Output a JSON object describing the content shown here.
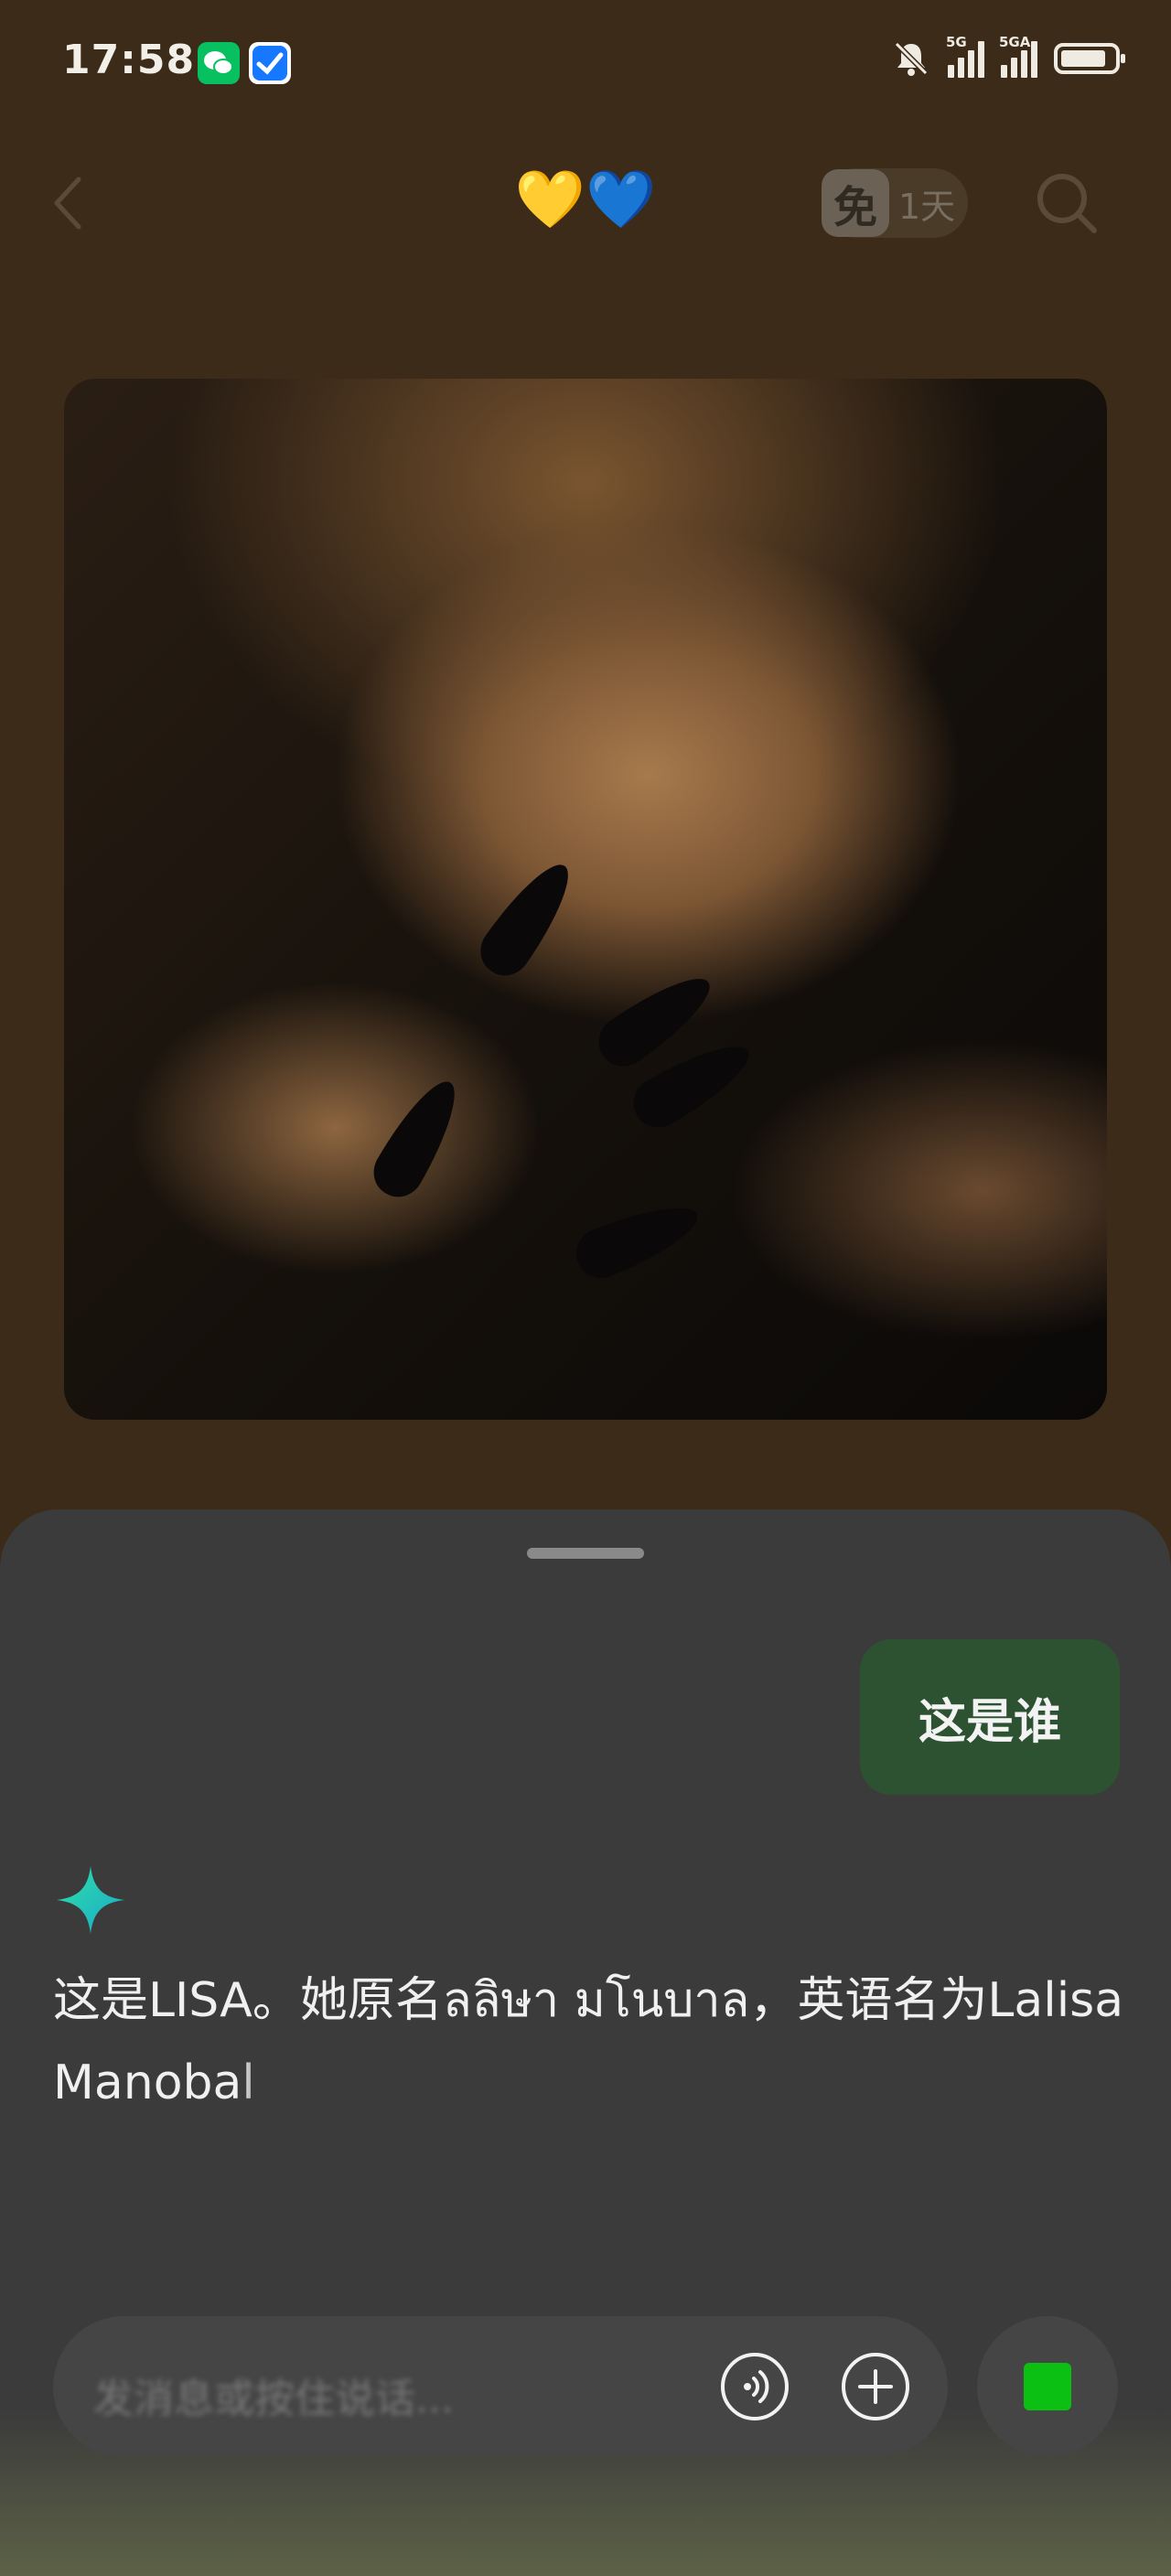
{
  "status_bar": {
    "time": "17:58",
    "apps": [
      "wechat-icon",
      "alipay-icon"
    ],
    "network_1": "5G",
    "network_2": "5GA",
    "icons": [
      "mute-bell-icon",
      "signal-icon",
      "battery-icon"
    ]
  },
  "nav": {
    "title_emoji": "💛💙",
    "free_badge": "免",
    "free_days": "1天",
    "icons": [
      "back-chevron-icon",
      "search-icon"
    ]
  },
  "photo": {
    "alt_icon": "portrait-image"
  },
  "chat": {
    "user_message": "这是谁",
    "ai_response_main": "这是LISA。她原名ลลิษา มโนบาล，英语名为Lalisa Manoba",
    "ai_response_fading": "l",
    "icons": [
      "sparkle-icon"
    ]
  },
  "composer": {
    "placeholder": "发消息或按住说话...",
    "icons": [
      "voice-call-icon",
      "plus-icon",
      "stop-icon"
    ]
  },
  "colors": {
    "background": "#3c2b18",
    "sheet": "#3b3b3b",
    "user_bubble": "#2d5231",
    "stop": "#0bbf13"
  }
}
